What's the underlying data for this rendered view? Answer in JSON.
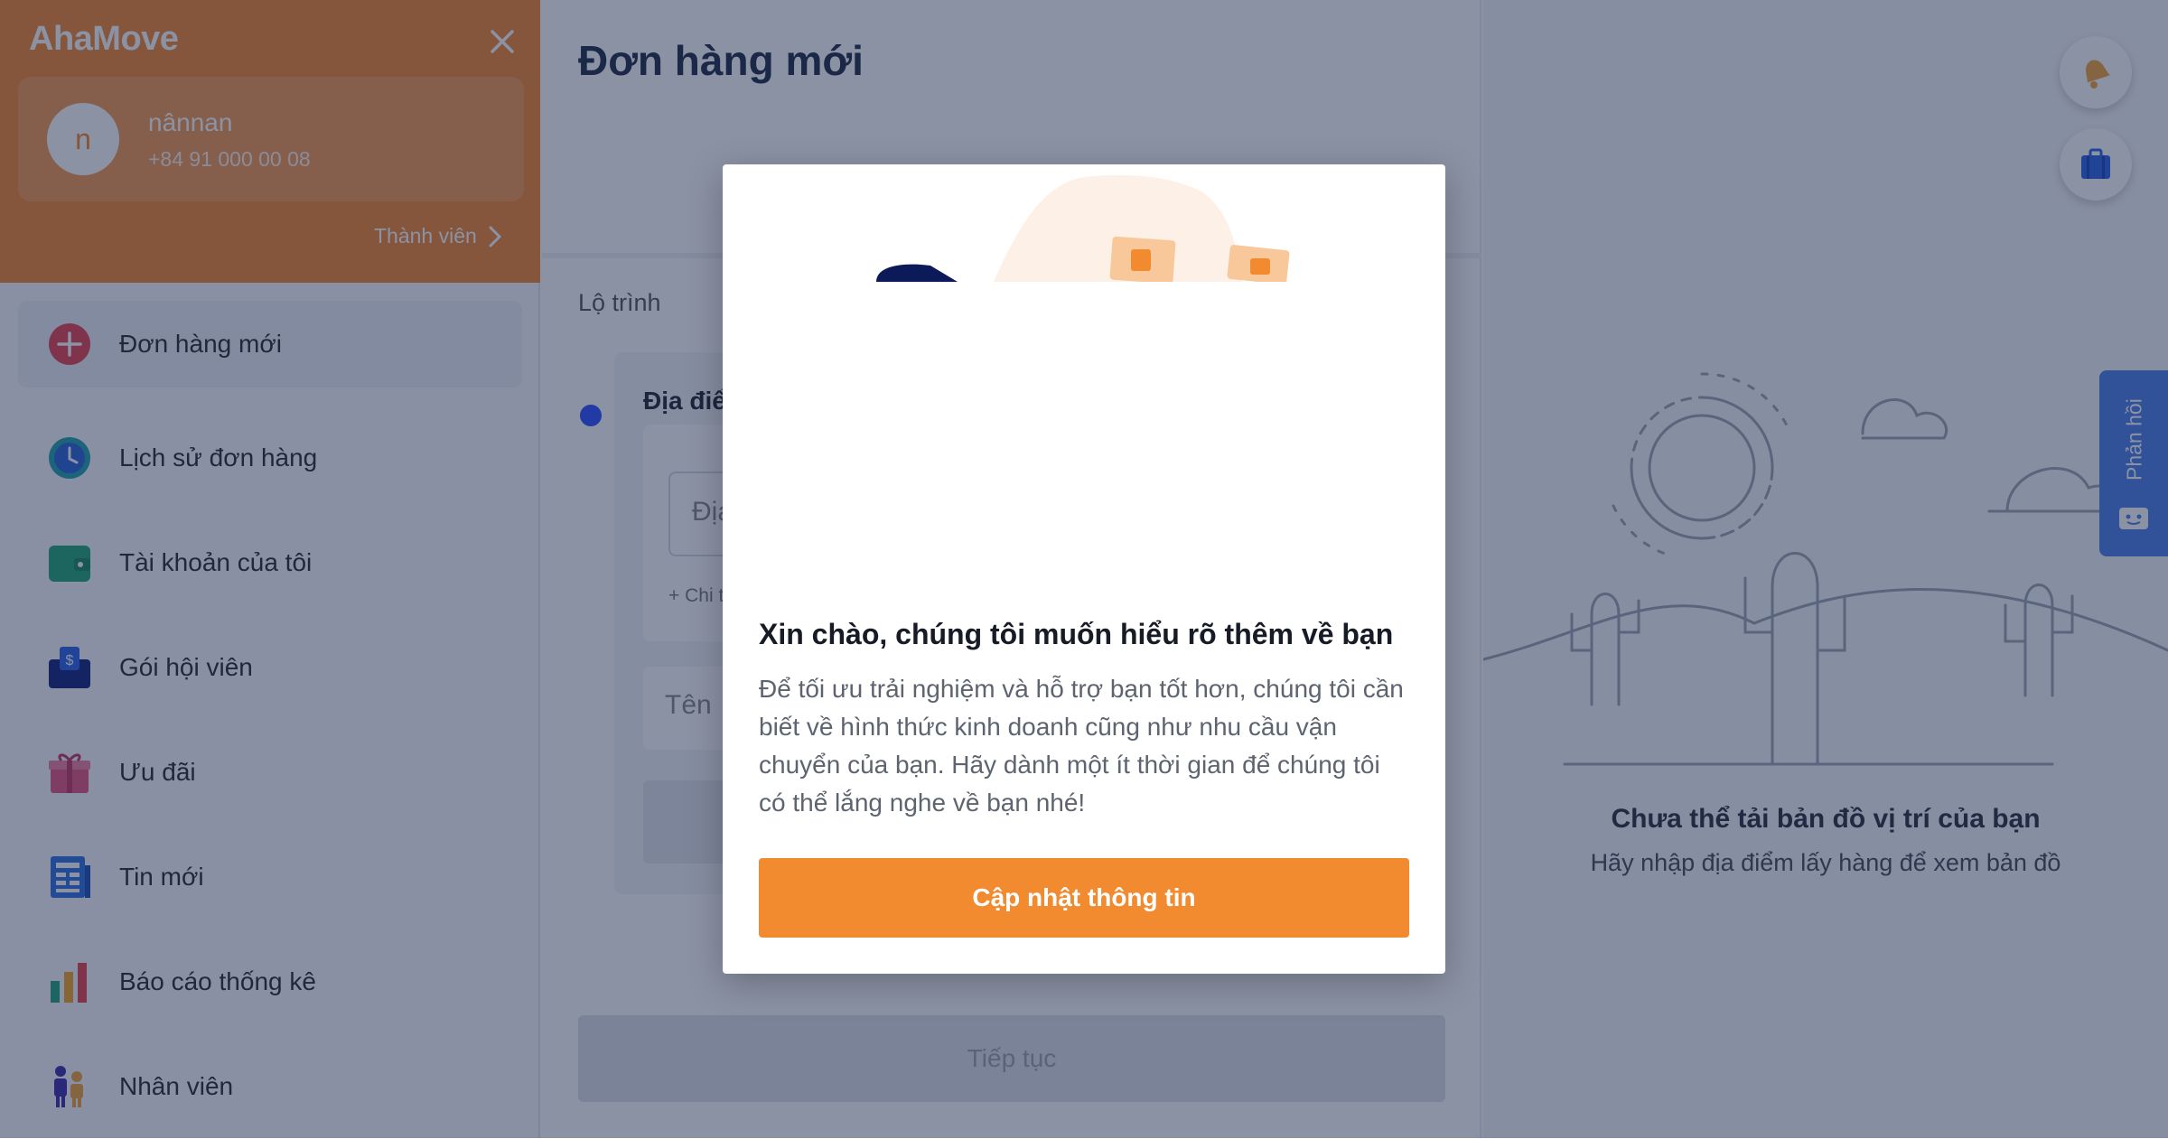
{
  "sidebar": {
    "logo": "AhaMove",
    "user": {
      "avatar_initial": "n",
      "name": "nânnan",
      "phone": "+84 91 000 00 08"
    },
    "member_link": "Thành viên",
    "items": [
      {
        "label": "Đơn hàng mới",
        "icon": "plus-circle-icon"
      },
      {
        "label": "Lịch sử đơn hàng",
        "icon": "clock-icon"
      },
      {
        "label": "Tài khoản của tôi",
        "icon": "wallet-icon"
      },
      {
        "label": "Gói hội viên",
        "icon": "membership-icon"
      },
      {
        "label": "Ưu đãi",
        "icon": "gift-icon"
      },
      {
        "label": "Tin mới",
        "icon": "news-icon"
      },
      {
        "label": "Báo cáo thống kê",
        "icon": "bar-chart-icon"
      },
      {
        "label": "Nhân viên",
        "icon": "staff-icon"
      }
    ]
  },
  "main": {
    "title": "Đơn hàng mới",
    "route_label": "Lộ trình",
    "stop_title": "Địa điể",
    "address_placeholder": "Địa",
    "address_detail": "+ Chi t",
    "name_placeholder": "Tên",
    "continue_label": "Tiếp tục"
  },
  "map": {
    "title": "Chưa thể tải bản đồ vị trí của bạn",
    "subtitle": "Hãy nhập địa điểm lấy hàng để xem bản đồ",
    "feedback_label": "Phản hồi"
  },
  "modal": {
    "title": "Xin chào, chúng tôi muốn hiểu rõ thêm về bạn",
    "body": "Để tối ưu trải nghiệm và hỗ trợ bạn tốt hơn, chúng tôi cần biết về hình thức kinh doanh cũng như nhu cầu vận chuyển của bạn. Hãy dành một ít thời gian để chúng tôi có thể lắng nghe về bạn nhé!",
    "button_label": "Cập nhật thông tin"
  },
  "colors": {
    "brand_orange": "#f2862d",
    "overlay": "#17264a",
    "feedback_blue": "#4a7ee6",
    "route_dot": "#2b4eff"
  }
}
